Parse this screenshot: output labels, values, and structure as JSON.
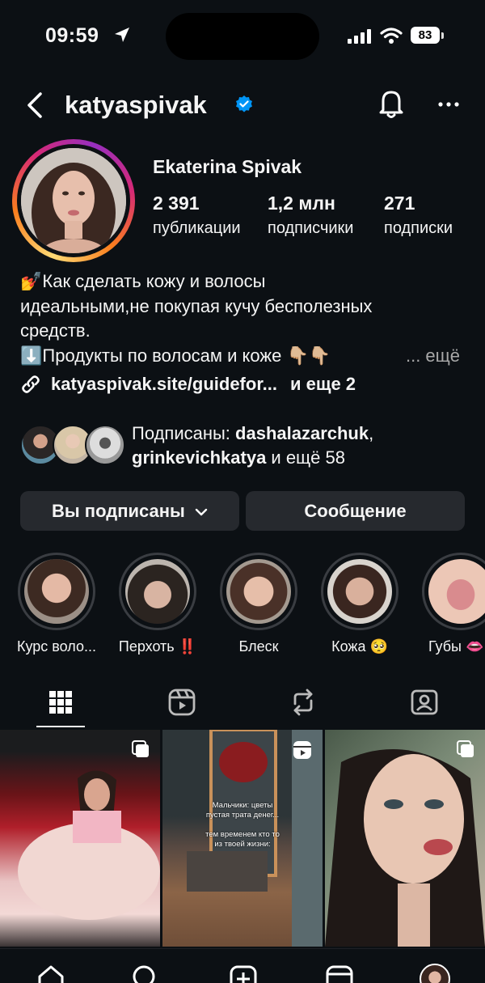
{
  "status_bar": {
    "time": "09:59",
    "battery": "83"
  },
  "header": {
    "username": "katyaspivak"
  },
  "profile": {
    "full_name": "Ekaterina Spivak",
    "stats": [
      {
        "value": "2 391",
        "label": "публикации"
      },
      {
        "value": "1,2 млн",
        "label": "подписчики"
      },
      {
        "value": "271",
        "label": "подписки"
      }
    ],
    "bio": {
      "line1": "💅Как сделать кожу и волосы",
      "line2": "идеальными,не покупая кучу бесполезных",
      "line3": "средств.",
      "line4": "⬇️Продукты по волосам и коже 👇🏼👇🏼",
      "more": "... ещё"
    },
    "link": {
      "text": "katyaspivak.site/guidefor...",
      "extra": "и еще 2"
    },
    "followed_by": {
      "prefix": "Подписаны: ",
      "user1": "dashalazarchuk",
      "sep": ",",
      "user2": "grinkevichkatya",
      "suffix": " и ещё 58"
    }
  },
  "actions": {
    "following": "Вы подписаны",
    "message": "Сообщение"
  },
  "highlights": [
    {
      "label": "Курс воло...",
      "color": "#b98c7a"
    },
    {
      "label": "Перхоть ‼️",
      "color": "#8f8a86"
    },
    {
      "label": "Блеск",
      "color": "#caa08c"
    },
    {
      "label": "Кожа 🥺",
      "color": "#c9a896"
    },
    {
      "label": "Губы 👄",
      "color": "#e0a8a8"
    }
  ],
  "posts": [
    {
      "type": "carousel",
      "caption": ""
    },
    {
      "type": "reel",
      "caption_line1": "Мальчики: цветы",
      "caption_line2": "пустая трата денег...",
      "caption_line3": "тем временем кто то",
      "caption_line4": "из твоей жизни:"
    },
    {
      "type": "carousel",
      "caption": ""
    }
  ],
  "icons": {
    "back": "chevron-left-icon",
    "verified": "verified-badge-icon",
    "bell": "bell-icon",
    "more": "more-horizontal-icon",
    "grid": "grid-icon",
    "reels": "reels-icon",
    "reposts": "repost-icon",
    "tagged": "tagged-icon",
    "home": "home-icon",
    "search": "search-icon",
    "create": "create-icon",
    "profile": "profile-avatar-icon"
  }
}
